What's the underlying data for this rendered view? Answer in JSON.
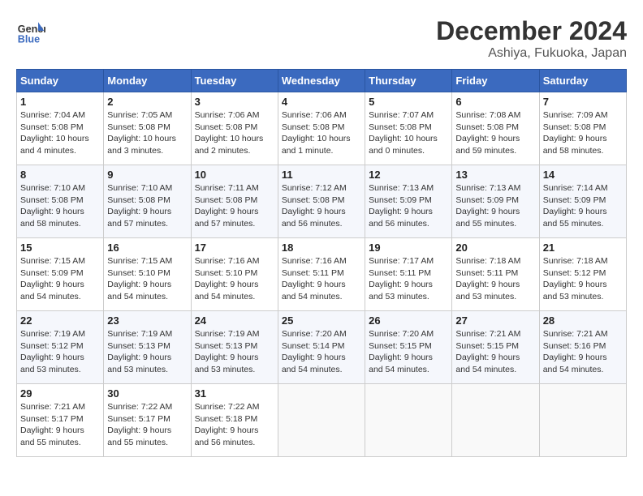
{
  "header": {
    "logo_line1": "General",
    "logo_line2": "Blue",
    "month_title": "December 2024",
    "location": "Ashiya, Fukuoka, Japan"
  },
  "calendar": {
    "weekdays": [
      "Sunday",
      "Monday",
      "Tuesday",
      "Wednesday",
      "Thursday",
      "Friday",
      "Saturday"
    ],
    "weeks": [
      [
        {
          "day": "1",
          "info": "Sunrise: 7:04 AM\nSunset: 5:08 PM\nDaylight: 10 hours\nand 4 minutes."
        },
        {
          "day": "2",
          "info": "Sunrise: 7:05 AM\nSunset: 5:08 PM\nDaylight: 10 hours\nand 3 minutes."
        },
        {
          "day": "3",
          "info": "Sunrise: 7:06 AM\nSunset: 5:08 PM\nDaylight: 10 hours\nand 2 minutes."
        },
        {
          "day": "4",
          "info": "Sunrise: 7:06 AM\nSunset: 5:08 PM\nDaylight: 10 hours\nand 1 minute."
        },
        {
          "day": "5",
          "info": "Sunrise: 7:07 AM\nSunset: 5:08 PM\nDaylight: 10 hours\nand 0 minutes."
        },
        {
          "day": "6",
          "info": "Sunrise: 7:08 AM\nSunset: 5:08 PM\nDaylight: 9 hours\nand 59 minutes."
        },
        {
          "day": "7",
          "info": "Sunrise: 7:09 AM\nSunset: 5:08 PM\nDaylight: 9 hours\nand 58 minutes."
        }
      ],
      [
        {
          "day": "8",
          "info": "Sunrise: 7:10 AM\nSunset: 5:08 PM\nDaylight: 9 hours\nand 58 minutes."
        },
        {
          "day": "9",
          "info": "Sunrise: 7:10 AM\nSunset: 5:08 PM\nDaylight: 9 hours\nand 57 minutes."
        },
        {
          "day": "10",
          "info": "Sunrise: 7:11 AM\nSunset: 5:08 PM\nDaylight: 9 hours\nand 57 minutes."
        },
        {
          "day": "11",
          "info": "Sunrise: 7:12 AM\nSunset: 5:08 PM\nDaylight: 9 hours\nand 56 minutes."
        },
        {
          "day": "12",
          "info": "Sunrise: 7:13 AM\nSunset: 5:09 PM\nDaylight: 9 hours\nand 56 minutes."
        },
        {
          "day": "13",
          "info": "Sunrise: 7:13 AM\nSunset: 5:09 PM\nDaylight: 9 hours\nand 55 minutes."
        },
        {
          "day": "14",
          "info": "Sunrise: 7:14 AM\nSunset: 5:09 PM\nDaylight: 9 hours\nand 55 minutes."
        }
      ],
      [
        {
          "day": "15",
          "info": "Sunrise: 7:15 AM\nSunset: 5:09 PM\nDaylight: 9 hours\nand 54 minutes."
        },
        {
          "day": "16",
          "info": "Sunrise: 7:15 AM\nSunset: 5:10 PM\nDaylight: 9 hours\nand 54 minutes."
        },
        {
          "day": "17",
          "info": "Sunrise: 7:16 AM\nSunset: 5:10 PM\nDaylight: 9 hours\nand 54 minutes."
        },
        {
          "day": "18",
          "info": "Sunrise: 7:16 AM\nSunset: 5:11 PM\nDaylight: 9 hours\nand 54 minutes."
        },
        {
          "day": "19",
          "info": "Sunrise: 7:17 AM\nSunset: 5:11 PM\nDaylight: 9 hours\nand 53 minutes."
        },
        {
          "day": "20",
          "info": "Sunrise: 7:18 AM\nSunset: 5:11 PM\nDaylight: 9 hours\nand 53 minutes."
        },
        {
          "day": "21",
          "info": "Sunrise: 7:18 AM\nSunset: 5:12 PM\nDaylight: 9 hours\nand 53 minutes."
        }
      ],
      [
        {
          "day": "22",
          "info": "Sunrise: 7:19 AM\nSunset: 5:12 PM\nDaylight: 9 hours\nand 53 minutes."
        },
        {
          "day": "23",
          "info": "Sunrise: 7:19 AM\nSunset: 5:13 PM\nDaylight: 9 hours\nand 53 minutes."
        },
        {
          "day": "24",
          "info": "Sunrise: 7:19 AM\nSunset: 5:13 PM\nDaylight: 9 hours\nand 53 minutes."
        },
        {
          "day": "25",
          "info": "Sunrise: 7:20 AM\nSunset: 5:14 PM\nDaylight: 9 hours\nand 54 minutes."
        },
        {
          "day": "26",
          "info": "Sunrise: 7:20 AM\nSunset: 5:15 PM\nDaylight: 9 hours\nand 54 minutes."
        },
        {
          "day": "27",
          "info": "Sunrise: 7:21 AM\nSunset: 5:15 PM\nDaylight: 9 hours\nand 54 minutes."
        },
        {
          "day": "28",
          "info": "Sunrise: 7:21 AM\nSunset: 5:16 PM\nDaylight: 9 hours\nand 54 minutes."
        }
      ],
      [
        {
          "day": "29",
          "info": "Sunrise: 7:21 AM\nSunset: 5:17 PM\nDaylight: 9 hours\nand 55 minutes."
        },
        {
          "day": "30",
          "info": "Sunrise: 7:22 AM\nSunset: 5:17 PM\nDaylight: 9 hours\nand 55 minutes."
        },
        {
          "day": "31",
          "info": "Sunrise: 7:22 AM\nSunset: 5:18 PM\nDaylight: 9 hours\nand 56 minutes."
        },
        {
          "day": "",
          "info": ""
        },
        {
          "day": "",
          "info": ""
        },
        {
          "day": "",
          "info": ""
        },
        {
          "day": "",
          "info": ""
        }
      ]
    ]
  }
}
